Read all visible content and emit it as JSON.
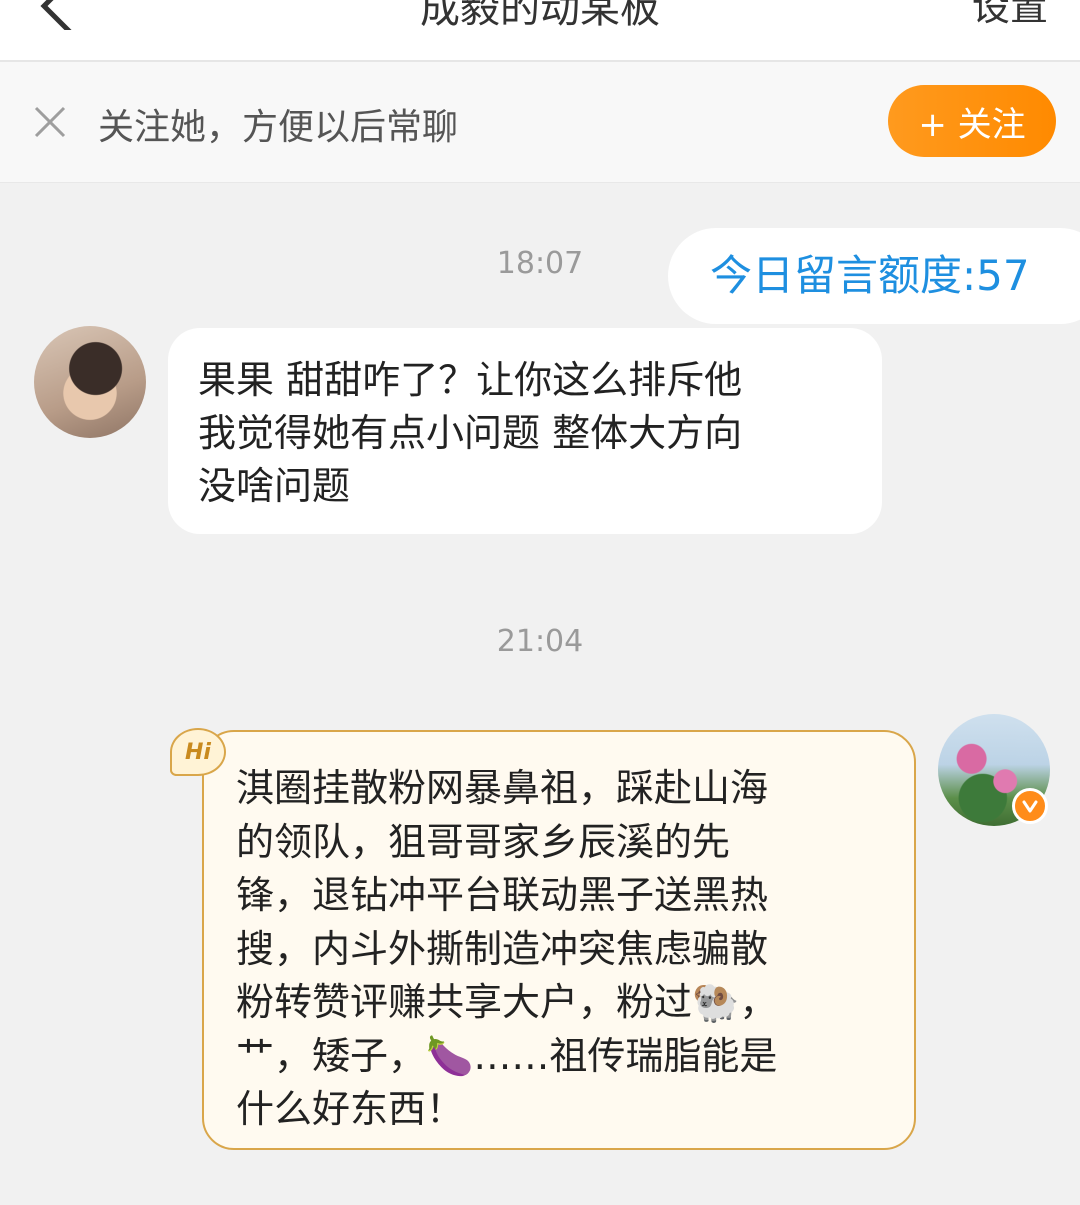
{
  "header": {
    "title": "成毅的动某板",
    "settings_label": "设置"
  },
  "follow_bar": {
    "text": "关注她，方便以后常聊",
    "button_label": "+ 关注"
  },
  "messages": [
    {
      "time": "18:07",
      "sender": "me",
      "text": "今日留言额度:57"
    },
    {
      "sender": "other",
      "lines": [
        "果果 甜甜咋了？让你这么排斥他",
        "我觉得她有点小问题 整体大方向",
        "没啥问题"
      ]
    },
    {
      "time": "21:04",
      "sender": "me",
      "badge": "Hi",
      "lines": [
        "淇圈挂散粉网暴鼻祖，踩赴山海",
        "的领队，狙哥哥家乡辰溪的先",
        "锋，退钻冲平台联动黑子送黑热",
        "搜，内斗外撕制造冲突焦虑骗散",
        "粉转赞评赚共享大户，粉过🐏，",
        "艹，矮子，🍆……祖传瑞脂能是",
        "什么好东西！"
      ]
    }
  ]
}
